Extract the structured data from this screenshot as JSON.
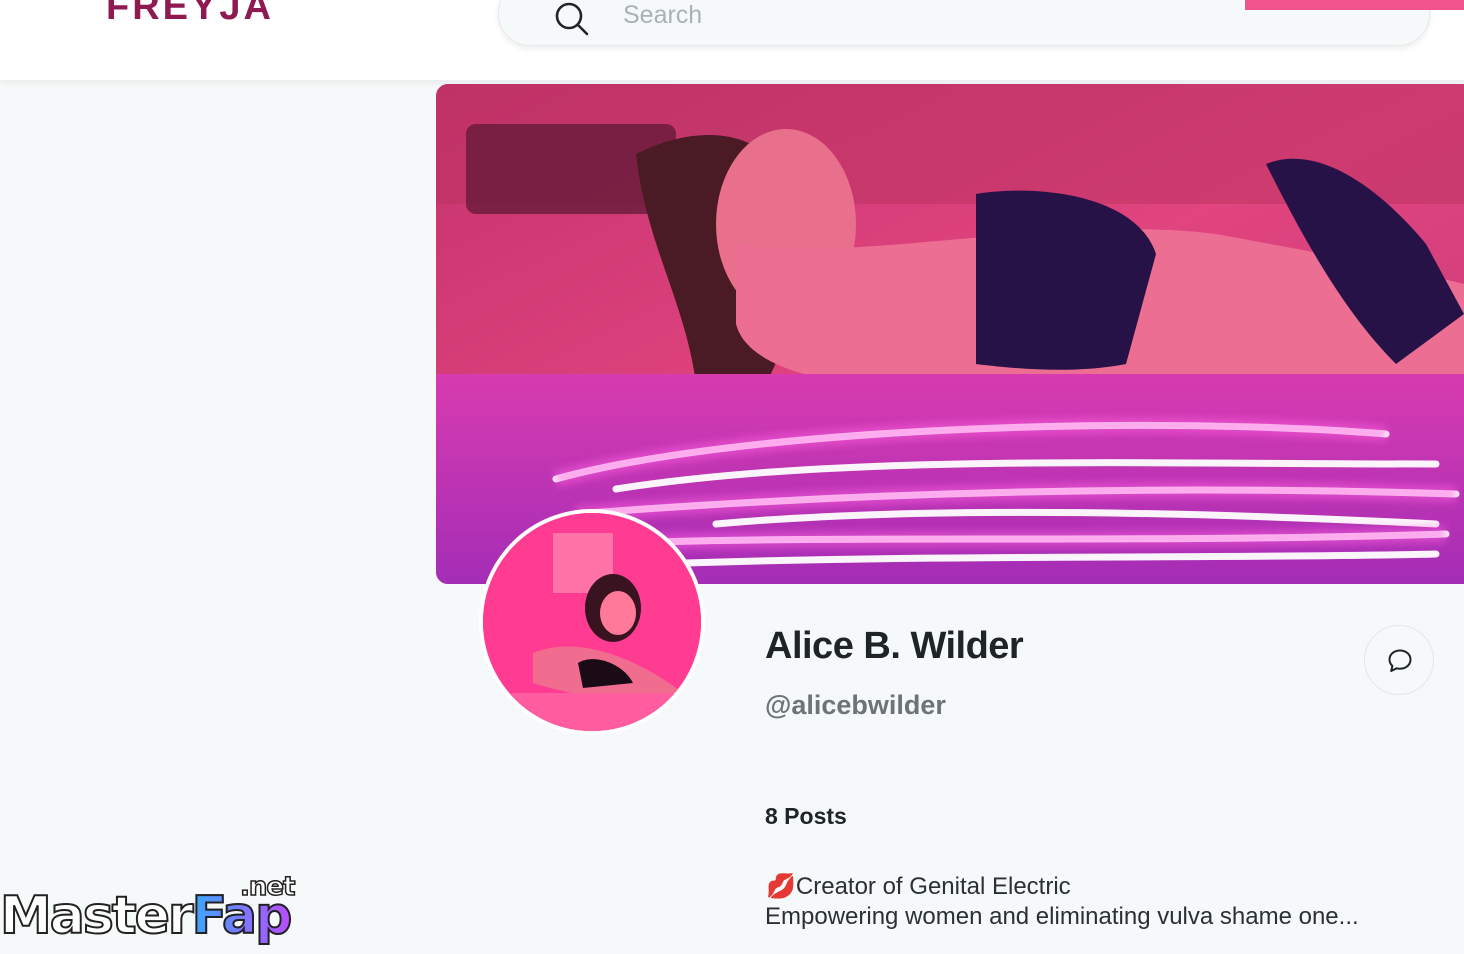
{
  "header": {
    "logo_text": "FREYJA",
    "search_placeholder": "Search",
    "brand_color": "#8f1a52",
    "accent_color": "#f0548c"
  },
  "profile": {
    "display_name": "Alice B. Wilder",
    "handle": "@alicebwilder",
    "posts_count": "8 Posts",
    "bio_emoji": "💋",
    "bio_line1": "Creator of Genital Electric",
    "bio_line2": "Empowering women and eliminating vulva shame one..."
  },
  "icons": {
    "search": "search-icon",
    "message": "chat-bubble-icon"
  },
  "watermark": {
    "main_left": "Master",
    "main_right": "Fap",
    "suffix": ".net"
  }
}
